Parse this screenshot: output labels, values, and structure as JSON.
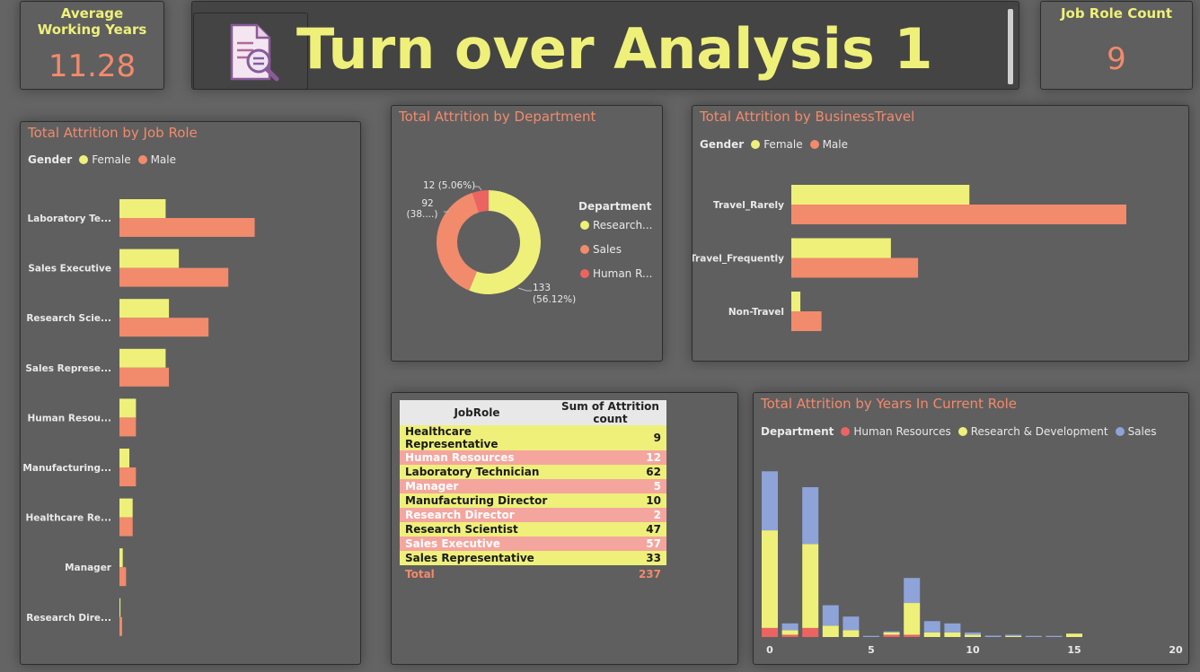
{
  "kpi_avg": {
    "label": "Average Working Years",
    "value": "11.28"
  },
  "kpi_jobrole": {
    "label": "Job Role Count",
    "value": "9"
  },
  "header": {
    "title": "Turn over Analysis 1"
  },
  "colors": {
    "female": "#eef07a",
    "male": "#f28a6c",
    "hr": "#ec6461",
    "rd": "#eef07a",
    "sales": "#8ea3d8"
  },
  "job_role_chart": {
    "title": "Total Attrition by Job Role",
    "legend_title": "Gender",
    "legend": [
      "Female",
      "Male"
    ]
  },
  "department_chart": {
    "title": "Total Attrition by Department",
    "legend_title": "Department",
    "legend": [
      "Research...",
      "Sales",
      "Human R..."
    ]
  },
  "travel_chart": {
    "title": "Total Attrition by BusinessTravel",
    "legend_title": "Gender",
    "legend": [
      "Female",
      "Male"
    ]
  },
  "years_chart": {
    "title": "Total Attrition by Years In Current Role",
    "legend_title": "Department",
    "legend": [
      "Human Resources",
      "Research & Development",
      "Sales"
    ]
  },
  "table": {
    "headers": [
      "JobRole",
      "Sum of Attrition count"
    ],
    "rows": [
      [
        "Healthcare Representative",
        "9"
      ],
      [
        "Human Resources",
        "12"
      ],
      [
        "Laboratory Technician",
        "62"
      ],
      [
        "Manager",
        "5"
      ],
      [
        "Manufacturing Director",
        "10"
      ],
      [
        "Research Director",
        "2"
      ],
      [
        "Research Scientist",
        "47"
      ],
      [
        "Sales Executive",
        "57"
      ],
      [
        "Sales Representative",
        "33"
      ]
    ],
    "total_label": "Total",
    "total_value": "237"
  },
  "chart_data": [
    {
      "type": "bar",
      "orientation": "horizontal",
      "title": "Total Attrition by Job Role",
      "categories": [
        "Laboratory Te...",
        "Sales Executive",
        "Research Scie...",
        "Sales Represe...",
        "Human Resou...",
        "Manufacturing...",
        "Healthcare Re...",
        "Manager",
        "Research Dire..."
      ],
      "series": [
        {
          "name": "Female",
          "values": [
            14,
            18,
            15,
            14,
            5,
            3,
            4,
            1,
            0.3
          ]
        },
        {
          "name": "Male",
          "values": [
            41,
            33,
            27,
            15,
            5,
            5,
            4,
            2,
            0.8
          ]
        }
      ],
      "xlim": [
        0,
        55
      ],
      "legend_position": "top-left"
    },
    {
      "type": "pie",
      "donut": true,
      "title": "Total Attrition by Department",
      "labels": [
        "Research...",
        "Sales",
        "Human R..."
      ],
      "values": [
        133,
        92,
        12
      ],
      "data_labels": [
        "133 (56.12%)",
        "92 (38....)",
        "12 (5.06%)"
      ],
      "legend_position": "right"
    },
    {
      "type": "bar",
      "orientation": "horizontal",
      "title": "Total Attrition by BusinessTravel",
      "categories": [
        "Travel_Rarely",
        "Travel_Frequently",
        "Non-Travel"
      ],
      "series": [
        {
          "name": "Female",
          "values": [
            59,
            33,
            3
          ]
        },
        {
          "name": "Male",
          "values": [
            111,
            42,
            10
          ]
        }
      ],
      "xlim": [
        0,
        125
      ],
      "legend_position": "top-left"
    },
    {
      "type": "bar",
      "stacked": true,
      "title": "Total Attrition by Years In Current Role",
      "x": [
        0,
        1,
        2,
        3,
        4,
        5,
        6,
        7,
        8,
        9,
        10,
        11,
        12,
        13,
        14,
        15
      ],
      "series": [
        {
          "name": "Human Resources",
          "values": [
            4,
            1,
            4,
            0,
            0,
            0,
            1,
            1,
            0,
            0,
            0,
            0,
            0,
            0,
            0,
            0
          ]
        },
        {
          "name": "Research & Development",
          "values": [
            43,
            2,
            37,
            5,
            3,
            0,
            1,
            14,
            2,
            2,
            1,
            0,
            0.5,
            0,
            0,
            1.5
          ]
        },
        {
          "name": "Sales",
          "values": [
            26,
            3,
            25,
            9,
            6,
            0.5,
            0.5,
            11,
            5,
            4,
            1,
            0.6,
            0.5,
            0.5,
            0.5,
            0
          ]
        }
      ],
      "xticks": [
        0,
        5,
        10,
        15,
        20
      ],
      "xlim": [
        0,
        20
      ],
      "ylim": [
        0,
        80
      ],
      "legend_position": "top-left"
    }
  ]
}
